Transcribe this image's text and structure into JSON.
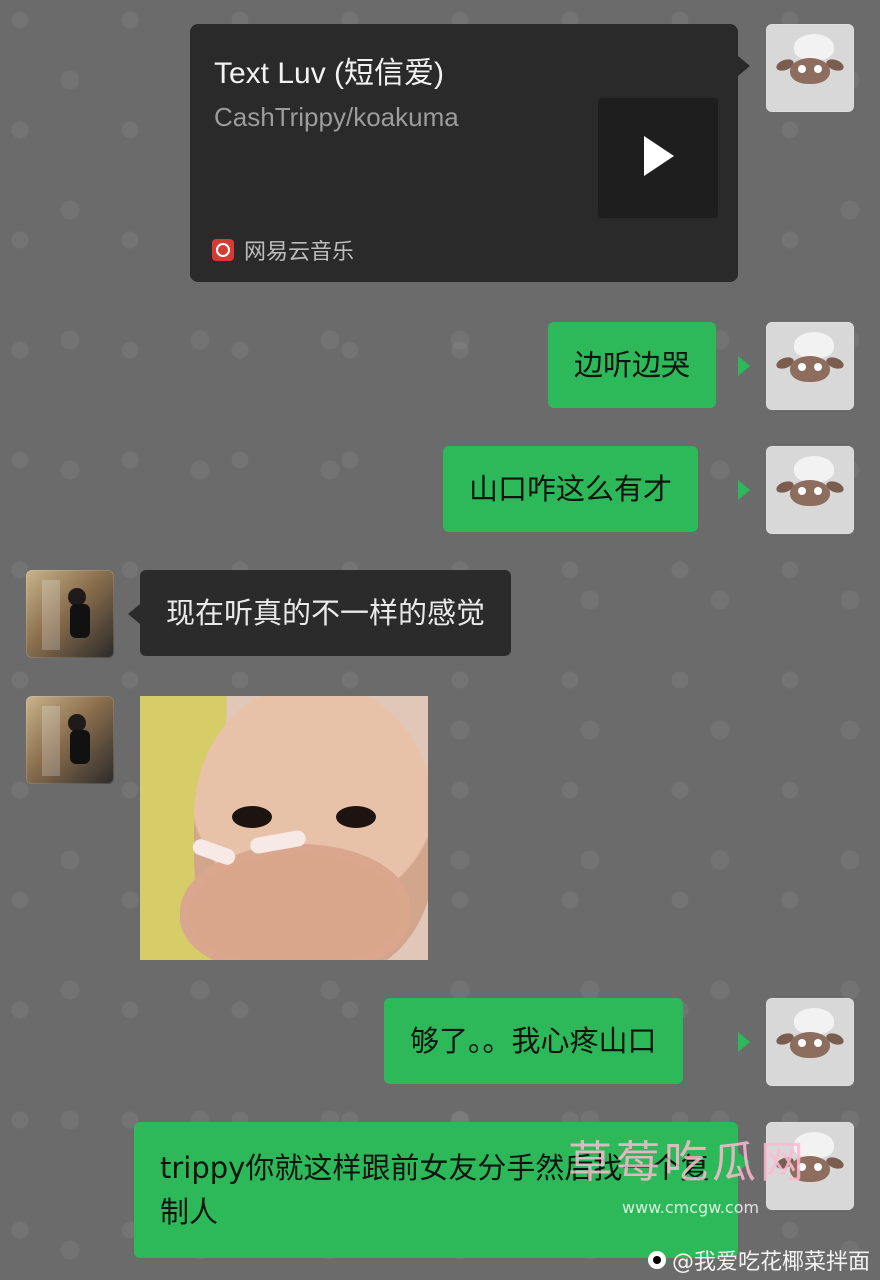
{
  "chat": {
    "music_card": {
      "title": "Text Luv (短信爱)",
      "artist": "CashTrippy/koakuma",
      "source": "网易云音乐"
    },
    "messages": [
      {
        "text": "边听边哭"
      },
      {
        "text": "山口咋这么有才"
      },
      {
        "text": "现在听真的不一样的感觉"
      },
      {
        "text": "够了。。我心疼山口"
      },
      {
        "text": "trippy你就这样跟前女友分手然后找一个复制人"
      }
    ]
  },
  "overlay": {
    "watermark_title": "草莓吃瓜网",
    "watermark_url": "www.cmcgw.com",
    "weibo_handle": "@我爱吃花椰菜拌面"
  }
}
